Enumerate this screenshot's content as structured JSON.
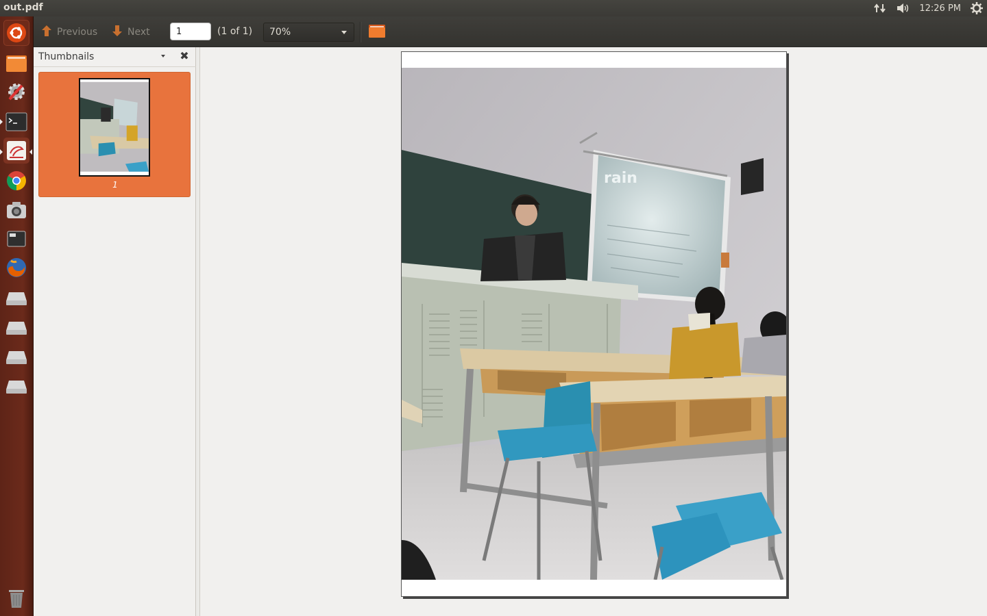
{
  "window": {
    "title": "out.pdf"
  },
  "indicators": {
    "clock": "12:26 PM"
  },
  "launcher": {
    "items": [
      "dash-home",
      "files",
      "system-settings",
      "terminal",
      "document-viewer",
      "chrome",
      "camera",
      "workspace",
      "firefox",
      "drive-1",
      "drive-2",
      "drive-3",
      "drive-4",
      "trash"
    ]
  },
  "toolbar": {
    "previous_label": "Previous",
    "next_label": "Next",
    "page_value": "1",
    "page_count": "(1 of 1)",
    "zoom_value": "70%"
  },
  "sidebar": {
    "title": "Thumbnails",
    "thumbnails": [
      {
        "label": "1"
      }
    ]
  },
  "photo": {
    "projector_text": "rain"
  },
  "colors": {
    "accent": "#e8733d",
    "launcher": "#6b2a1b",
    "toolbar": "#3b3a36"
  }
}
